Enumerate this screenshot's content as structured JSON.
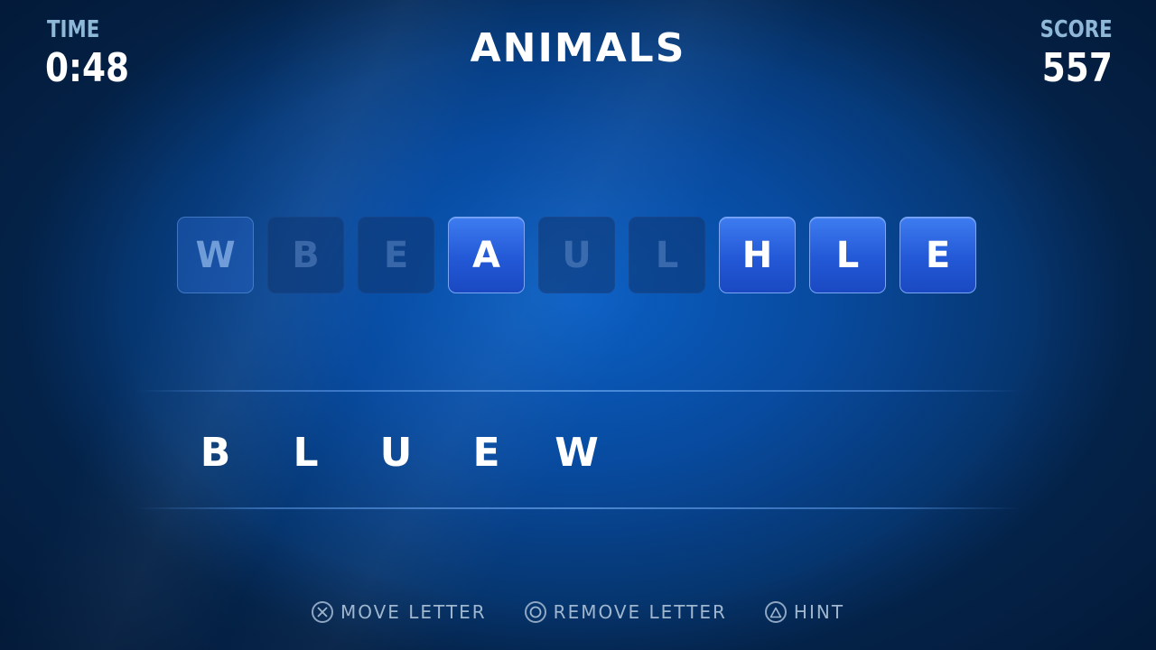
{
  "hud": {
    "time_label": "TIME",
    "time_value": "0:48",
    "score_label": "SCORE",
    "score_value": "557",
    "category": "ANIMALS"
  },
  "tiles": [
    {
      "letter": "W",
      "state": "selected"
    },
    {
      "letter": "B",
      "state": "used"
    },
    {
      "letter": "E",
      "state": "used"
    },
    {
      "letter": "A",
      "state": "active"
    },
    {
      "letter": "U",
      "state": "used"
    },
    {
      "letter": "L",
      "state": "used"
    },
    {
      "letter": "H",
      "state": "active"
    },
    {
      "letter": "L",
      "state": "active"
    },
    {
      "letter": "E",
      "state": "active"
    }
  ],
  "answer": [
    "B",
    "L",
    "U",
    "E",
    "W"
  ],
  "controls": [
    {
      "icon": "cross-button-icon",
      "label": "MOVE LETTER"
    },
    {
      "icon": "circle-button-icon",
      "label": "REMOVE LETTER"
    },
    {
      "icon": "triangle-button-icon",
      "label": "HINT"
    }
  ],
  "colors": {
    "background": "#0a5fc4",
    "tile_active": "#2358d6",
    "hud_label": "#8fb8d8",
    "controls_text": "#9fb6cf"
  }
}
